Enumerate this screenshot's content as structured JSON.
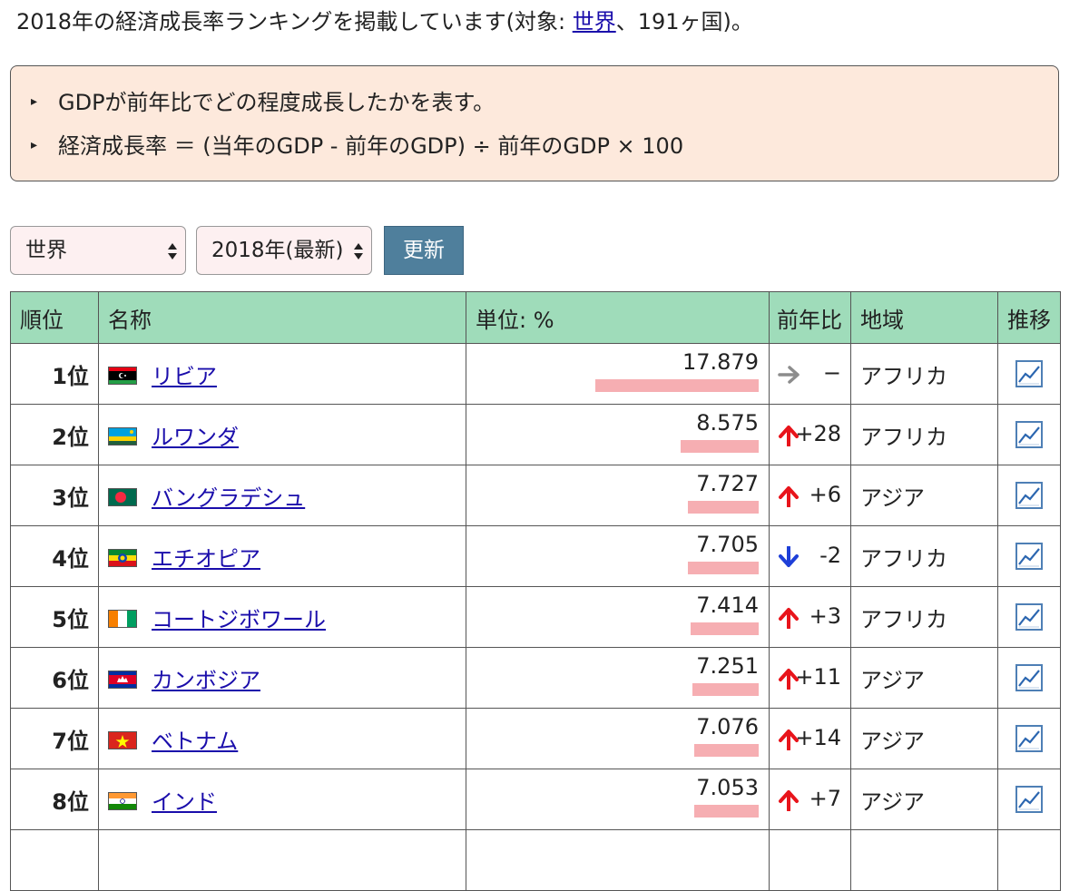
{
  "intro": {
    "text_before": "2018年の経済成長率ランキングを掲載しています(対象: ",
    "link": "世界",
    "text_after": "、191ヶ国)。"
  },
  "info": {
    "line1": "GDPが前年比でどの程度成長したかを表す。",
    "line2": "経済成長率 ＝ (当年のGDP - 前年のGDP) ÷ 前年のGDP × 100"
  },
  "controls": {
    "region_select": "世界",
    "year_select": "2018年(最新)",
    "update_button": "更新"
  },
  "table": {
    "headers": {
      "rank": "順位",
      "name": "名称",
      "unit": "単位: %",
      "change": "前年比",
      "region": "地域",
      "trend": "推移"
    },
    "rows": [
      {
        "rank": "1位",
        "name": "リビア",
        "value": "17.879",
        "value_num": 17.879,
        "direction": "flat",
        "change": "−",
        "region": "アフリカ",
        "flag": "libya"
      },
      {
        "rank": "2位",
        "name": "ルワンダ",
        "value": "8.575",
        "value_num": 8.575,
        "direction": "up",
        "change": "+28",
        "region": "アフリカ",
        "flag": "rwanda"
      },
      {
        "rank": "3位",
        "name": "バングラデシュ",
        "value": "7.727",
        "value_num": 7.727,
        "direction": "up",
        "change": "+6",
        "region": "アジア",
        "flag": "bangladesh"
      },
      {
        "rank": "4位",
        "name": "エチオピア",
        "value": "7.705",
        "value_num": 7.705,
        "direction": "down",
        "change": "-2",
        "region": "アフリカ",
        "flag": "ethiopia"
      },
      {
        "rank": "5位",
        "name": "コートジボワール",
        "value": "7.414",
        "value_num": 7.414,
        "direction": "up",
        "change": "+3",
        "region": "アフリカ",
        "flag": "cotedivoire"
      },
      {
        "rank": "6位",
        "name": "カンボジア",
        "value": "7.251",
        "value_num": 7.251,
        "direction": "up",
        "change": "+11",
        "region": "アジア",
        "flag": "cambodia"
      },
      {
        "rank": "7位",
        "name": "ベトナム",
        "value": "7.076",
        "value_num": 7.076,
        "direction": "up",
        "change": "+14",
        "region": "アジア",
        "flag": "vietnam"
      },
      {
        "rank": "8位",
        "name": "インド",
        "value": "7.053",
        "value_num": 7.053,
        "direction": "up",
        "change": "+7",
        "region": "アジア",
        "flag": "india"
      }
    ]
  },
  "colors": {
    "header_bg": "#9fdcba",
    "bar": "#f6aeb2",
    "arrow_up": "#e8141b",
    "arrow_down": "#1e3fd8",
    "arrow_flat": "#8c8c8c",
    "link": "#1a0dab",
    "button": "#4f7f9c"
  }
}
